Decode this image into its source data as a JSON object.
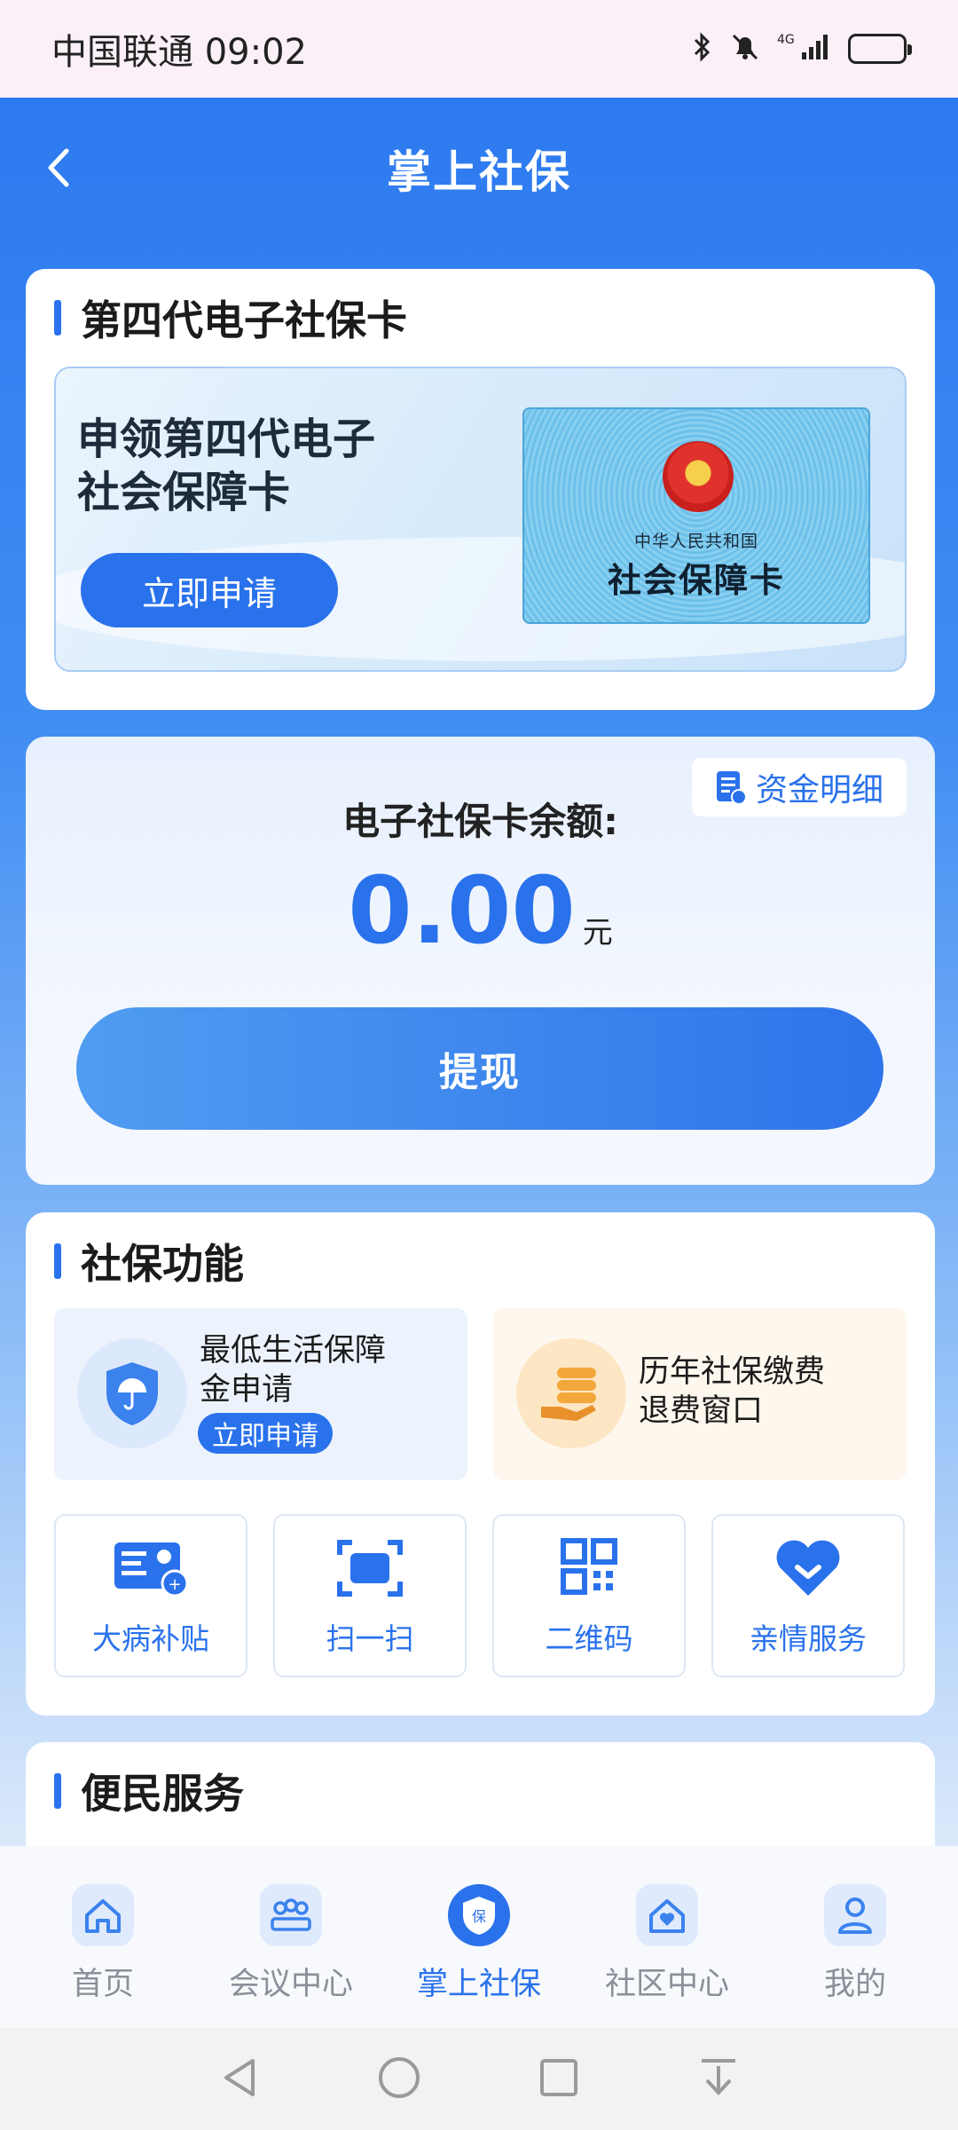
{
  "status_bar": {
    "carrier_time": "中国联通 09:02",
    "network": "4G"
  },
  "header": {
    "title": "掌上社保"
  },
  "apply_card": {
    "section_title": "第四代电子社保卡",
    "banner_text_line1": "申领第四代电子",
    "banner_text_line2": "社会保障卡",
    "apply_button": "立即申请",
    "card_small_text": "中华人民共和国",
    "card_big_text": "社会保障卡"
  },
  "balance_card": {
    "fund_detail_label": "资金明细",
    "balance_label": "电子社保卡余额:",
    "amount": "0.00",
    "unit": "元",
    "withdraw_button": "提现"
  },
  "functions": {
    "section_title": "社保功能",
    "feature_left_line1": "最低生活保障",
    "feature_left_line2": "金申请",
    "feature_left_tag": "立即申请",
    "feature_right_line1": "历年社保缴费",
    "feature_right_line2": "退费窗口",
    "tiles": [
      "大病补贴",
      "扫一扫",
      "二维码",
      "亲情服务"
    ]
  },
  "convenience": {
    "section_title": "便民服务"
  },
  "bottom_nav": {
    "items": [
      {
        "label": "首页",
        "icon": "home-icon"
      },
      {
        "label": "会议中心",
        "icon": "meeting-icon"
      },
      {
        "label": "掌上社保",
        "icon": "shield-icon",
        "active": true
      },
      {
        "label": "社区中心",
        "icon": "community-icon"
      },
      {
        "label": "我的",
        "icon": "user-icon"
      }
    ]
  },
  "colors": {
    "primary": "#2a72ec",
    "header_bg": "#2d7af0",
    "orange_accent": "#f3a73a"
  }
}
